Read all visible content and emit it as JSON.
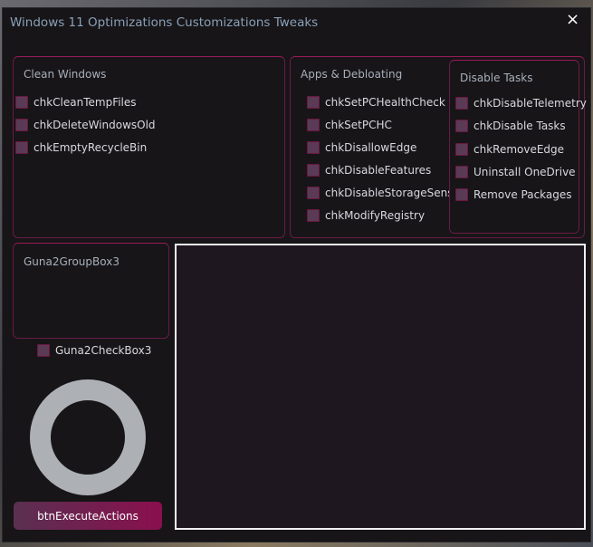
{
  "window": {
    "title": "Windows 11 Optimizations Customizations Tweaks",
    "close_icon": "×"
  },
  "clean_windows": {
    "label": "Clean Windows",
    "items": [
      "chkCleanTempFiles",
      "chkDeleteWindowsOld",
      "chkEmptyRecycleBin"
    ]
  },
  "apps": {
    "label": "Apps & Debloating",
    "items": [
      "chkSetPCHealthCheck",
      "chkSetPCHC",
      "chkDisallowEdge",
      "chkDisableFeatures",
      "chkDisableStorageSense",
      "chkModifyRegistry"
    ]
  },
  "disable_tasks": {
    "label": "Disable Tasks",
    "items": [
      "chkDisableTelemetry",
      "chkDisable Tasks",
      "chkRemoveEdge",
      "Uninstall OneDrive",
      "Remove Packages"
    ]
  },
  "group3": {
    "label": "Guna2GroupBox3"
  },
  "checkbox3": {
    "label": "Guna2CheckBox3"
  },
  "execute": {
    "label": "btnExecuteActions"
  },
  "colors": {
    "accent": "#8a0f4e",
    "checkbox": "#5a3a55",
    "ring": "#adb0b4"
  }
}
